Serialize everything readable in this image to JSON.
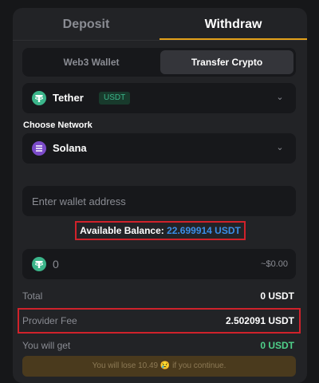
{
  "tabs": {
    "deposit": "Deposit",
    "withdraw": "Withdraw"
  },
  "subtabs": {
    "web3": "Web3 Wallet",
    "transfer": "Transfer Crypto"
  },
  "currency": {
    "name": "Tether",
    "badge": "USDT",
    "icon": "tether-usdt-icon"
  },
  "network": {
    "label": "Choose Network",
    "name": "Solana",
    "icon": "solana-icon"
  },
  "address": {
    "placeholder": "Enter wallet address"
  },
  "balance": {
    "label": "Available Balance:",
    "value": "22.699914 USDT"
  },
  "amount": {
    "value": "0",
    "usd": "~$0.00"
  },
  "summary": {
    "total_label": "Total",
    "total_value": "0 USDT",
    "fee_label": "Provider Fee",
    "fee_value": "2.502091 USDT",
    "get_label": "You will get",
    "get_value": "0 USDT"
  },
  "warning": "You will lose 10.49 😢 if you continue.",
  "colors": {
    "accent": "#e3a11a",
    "highlight": "#d0222b",
    "link": "#3a8fe8",
    "positive": "#4fd08a"
  }
}
